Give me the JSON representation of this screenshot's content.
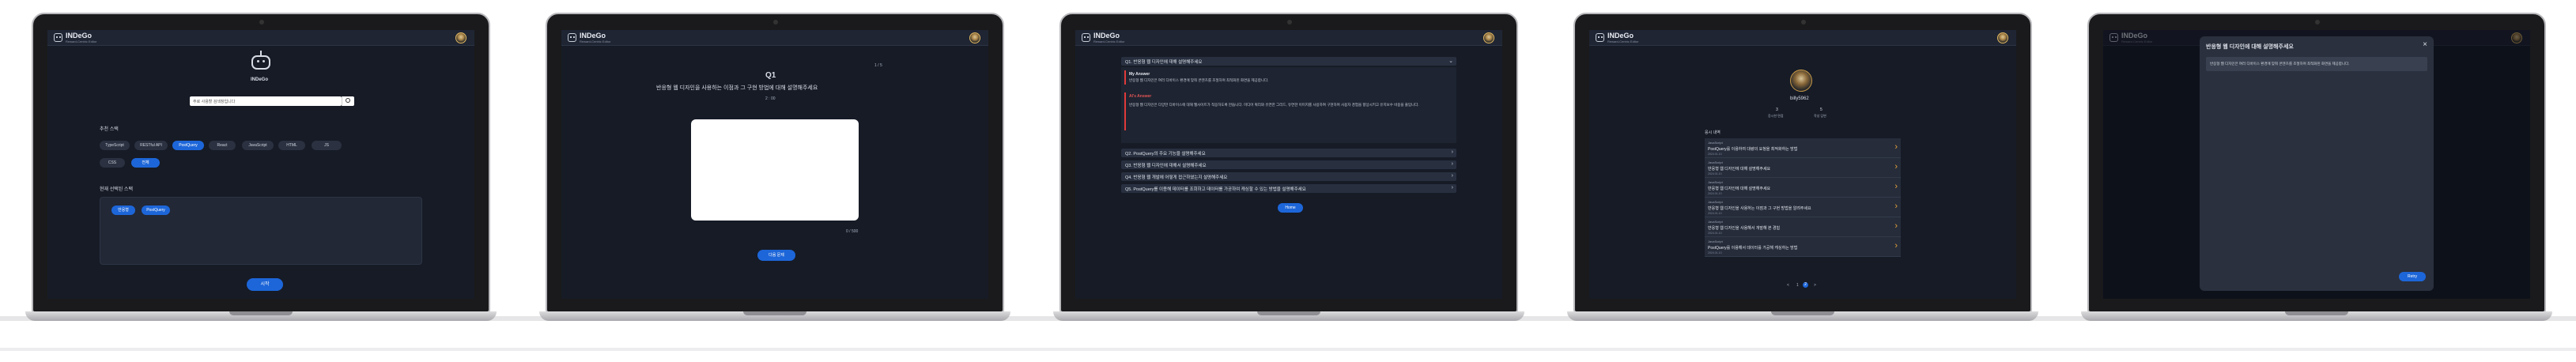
{
  "app": {
    "brand": "INDeGo",
    "brand_sub": "Reward-Centric Editor"
  },
  "screen1": {
    "robot_label": "INDeGo",
    "search_placeholder": "주로 사용할 검색창입니다",
    "section_skills": "추천 스택",
    "skills_row1": [
      "TypeScript",
      "RESTful API",
      "PostQuery",
      "React",
      "JavaScript",
      "HTML",
      "JS"
    ],
    "skills_row2": [
      "CSS",
      "전체"
    ],
    "selected_skill": "PostQuery",
    "section_selected": "현재 선택된 스택",
    "selected_chips": [
      "반응형",
      "PostQuery"
    ],
    "start_button": "시작"
  },
  "screen2": {
    "progress": "1 / 5",
    "question_no": "Q1",
    "question": "반응형 웹 디자인을 사용하는 이점과 그 구현 방법에 대해 설명해주세요",
    "timer": "2 : 00",
    "char_count": "0 / 500",
    "next_button": "다음 문제"
  },
  "screen3": {
    "q1_title": "Q1. 반응형 웹 디자인에 대해 설명해주세요",
    "my_answer_label": "My Answer",
    "my_answer": "반응형 웹 디자인은 여러 디바이스 환경에 맞춰 콘텐츠를 조절하며 최적화된 화면을 제공합니다.",
    "ai_answer_label": "AI's Answer",
    "ai_answer": "반응형 웹 디자인은 다양한 디바이스에 대해 웹사이트가 적응하도록 만듭니다. 미디어 쿼리와 유연한 그리드, 유연한 이미지를 사용하여 구현하며 사용자 경험을 향상시키고 유지보수 비용을 줄입니다.",
    "items": [
      "Q2. PostQuery의 주요 기능을 설명해주세요",
      "Q3. 반응형 웹 디자인에 대해서 설명해주세요",
      "Q4. 반응형 웹 개발에 어떻게 접근하였는지 설명해주세요",
      "Q5. PostQuery를 이용해 데이터를 조회하고 데이터를 가공하여 캐싱할 수 있는 방법을 설명해주세요"
    ],
    "home_button": "Home"
  },
  "screen4": {
    "username": "billy5962",
    "stat1_value": "3",
    "stat1_label": "응시한 면접",
    "stat2_value": "5",
    "stat2_label": "작성 답변",
    "section": "응시 내역",
    "rows": [
      {
        "tag": "JavaScript",
        "title": "PostQuery를 이용하여 대량의 요청을 최적화하는 방법",
        "date": "2024.01.10"
      },
      {
        "tag": "JavaScript",
        "title": "반응형 웹 디자인에 대해 설명해주세요",
        "date": "2024.01.10"
      },
      {
        "tag": "JavaScript",
        "title": "반응형 웹 디자인에 대해 설명해주세요",
        "date": "2024.01.10"
      },
      {
        "tag": "JavaScript",
        "title": "반응형 웹 디자인을 사용하는 이점과 그 구현 방법을 알려주세요",
        "date": "2024.01.10"
      },
      {
        "tag": "JavaScript",
        "title": "반응형 웹 디자인을 사용해서 개발해 본 경험",
        "date": "2024.01.10"
      },
      {
        "tag": "JavaScript",
        "title": "PostQuery를 이용해서 데이터를 가공해 캐싱하는 방법",
        "date": "2024.01.10"
      }
    ],
    "pages": [
      "<",
      "1",
      "2",
      ">"
    ]
  },
  "screen5": {
    "title": "반응형 웹 디자인에 대해 설명해주세요",
    "body": "반응형 웹 디자인은 여러 디바이스 환경에 맞춰 콘텐츠를 조절하며 최적화된 화면을 제공합니다.",
    "close_icon": "×",
    "button": "Retry"
  }
}
